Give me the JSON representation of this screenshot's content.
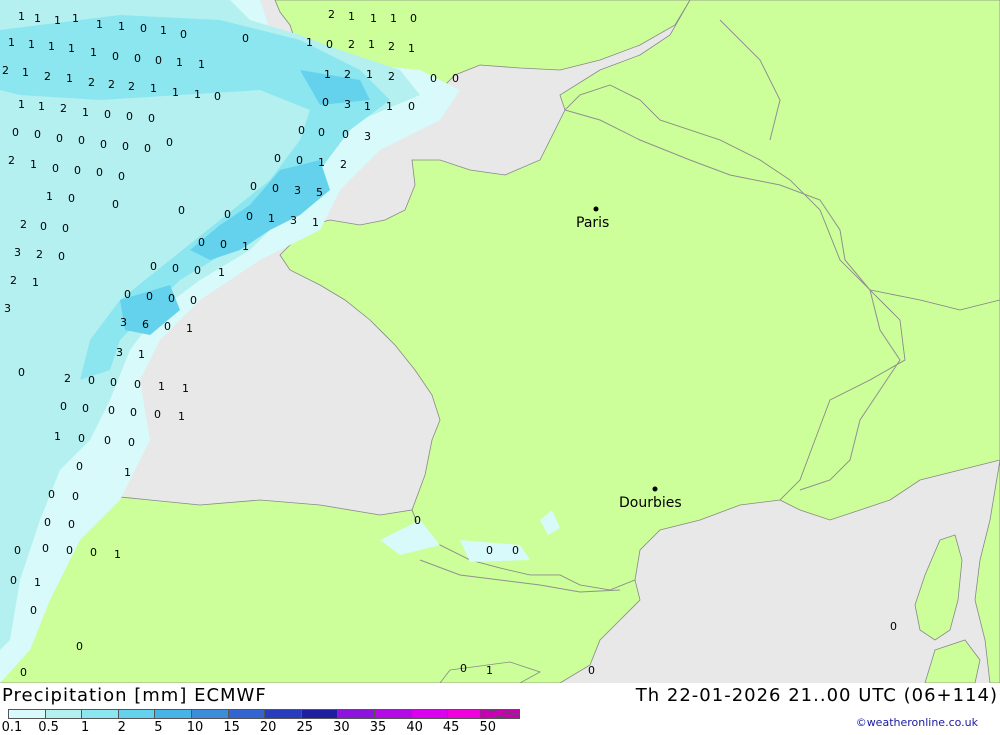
{
  "footer": {
    "title": "Precipitation [mm] ECMWF",
    "datetime": "Th 22-01-2026 21..00 UTC (06+114)",
    "credit": "©weatheronline.co.uk"
  },
  "legend": {
    "labels": [
      "0.1",
      "0.5",
      "1",
      "2",
      "5",
      "10",
      "15",
      "20",
      "25",
      "30",
      "35",
      "40",
      "45",
      "50"
    ],
    "colors": [
      "#d8fafa",
      "#b4f0f0",
      "#8ce6f0",
      "#64d2ec",
      "#46b4e6",
      "#3c8cdc",
      "#3264d2",
      "#283cbe",
      "#1e1ea0",
      "#8c14dc",
      "#b40ae6",
      "#dc00f0",
      "#f000dc",
      "#c800b4"
    ]
  },
  "colors": {
    "land": "#ccff99",
    "sea": "#e8e8e8",
    "border": "#909090",
    "precip_light": "#d8fafa",
    "precip_low": "#b4f0f0",
    "precip_mid": "#8ce6f0",
    "precip_high": "#64d2ec"
  },
  "cities": [
    {
      "name": "Paris"
    },
    {
      "name": "Dourbies"
    }
  ],
  "precip_values": [
    "1",
    "1",
    "1",
    "1",
    "1",
    "1",
    "0",
    "1",
    "0",
    "2",
    "1",
    "1",
    "1",
    "0",
    "1",
    "1",
    "1",
    "1",
    "1",
    "0",
    "0",
    "0",
    "1",
    "1",
    "1",
    "0",
    "2",
    "1",
    "2",
    "1",
    "0",
    "2",
    "1",
    "2",
    "1",
    "2",
    "2",
    "2",
    "1",
    "1",
    "1",
    "0",
    "1",
    "2",
    "1",
    "2",
    "0",
    "0",
    "1",
    "1",
    "2",
    "1",
    "0",
    "0",
    "0",
    "0",
    "3",
    "1",
    "1",
    "0",
    "0",
    "0",
    "0",
    "0",
    "0",
    "0",
    "0",
    "0",
    "0",
    "0",
    "0",
    "3",
    "2",
    "1",
    "0",
    "0",
    "0",
    "0",
    "0",
    "0",
    "1",
    "2",
    "1",
    "0",
    "0",
    "0",
    "0",
    "0",
    "3",
    "5",
    "2",
    "0",
    "0",
    "0",
    "0",
    "1",
    "3",
    "1",
    "3",
    "2",
    "0",
    "0",
    "0",
    "1",
    "2",
    "1",
    "0",
    "0",
    "0",
    "1",
    "3",
    "0",
    "0",
    "0",
    "0",
    "3",
    "6",
    "0",
    "1",
    "3",
    "1",
    "0",
    "2",
    "0",
    "0",
    "0",
    "1",
    "1",
    "0",
    "0",
    "0",
    "0",
    "0",
    "1",
    "1",
    "0",
    "0",
    "0",
    "0",
    "1",
    "0",
    "0",
    "0",
    "0",
    "0",
    "0",
    "0",
    "1",
    "0",
    "0",
    "1",
    "0",
    "0",
    "0",
    "0",
    "1",
    "0",
    "0",
    "0",
    "0",
    "0",
    "0"
  ]
}
